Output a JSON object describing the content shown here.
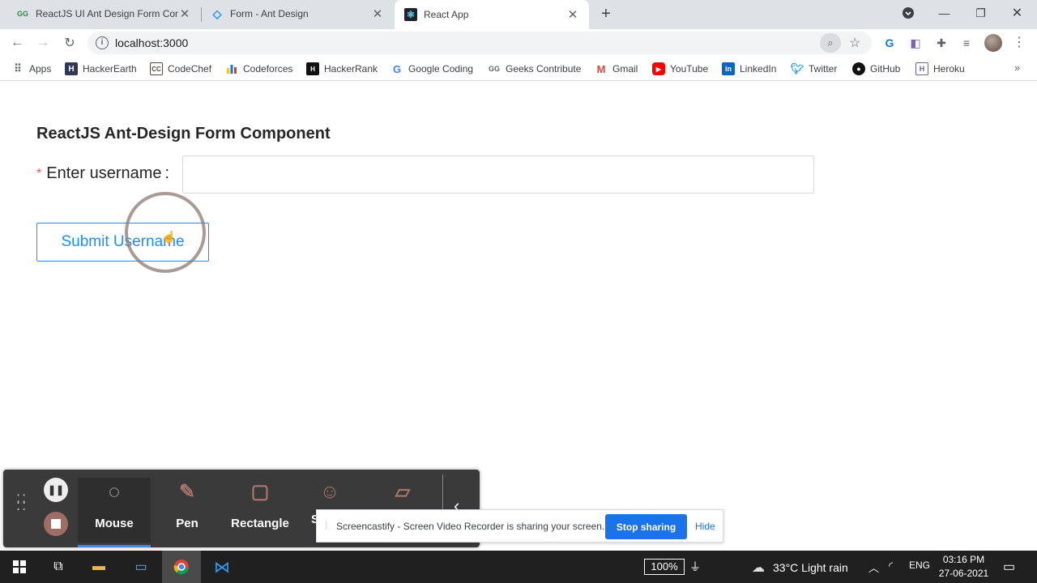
{
  "browser": {
    "tabs": [
      {
        "title": "ReactJS UI Ant Design Form Com",
        "favicon": "GG"
      },
      {
        "title": "Form - Ant Design",
        "favicon": "◇"
      },
      {
        "title": "React App",
        "favicon": "⚛"
      }
    ],
    "url": "localhost:3000",
    "bookmarks": [
      "Apps",
      "HackerEarth",
      "CodeChef",
      "Codeforces",
      "HackerRank",
      "Google Coding",
      "Geeks Contribute",
      "Gmail",
      "YouTube",
      "LinkedIn",
      "Twitter",
      "GitHub",
      "Heroku"
    ]
  },
  "page": {
    "title": "ReactJS Ant-Design Form Component",
    "field_required_mark": "*",
    "field_label": "Enter username",
    "field_colon": ":",
    "username_value": "",
    "submit_label": "Submit Username"
  },
  "recorder": {
    "tools": [
      "Mouse",
      "Pen",
      "Rectangle",
      "S"
    ],
    "active_tool": "Mouse",
    "share_message": "Screencastify - Screen Video Recorder is sharing your screen.",
    "stop_label": "Stop sharing",
    "hide_label": "Hide"
  },
  "taskbar": {
    "battery": "100%",
    "weather": "33°C  Light rain",
    "language": "ENG",
    "time": "03:16 PM",
    "date": "27-06-2021"
  },
  "colors": {
    "primary": "#1890ff",
    "required": "#ff4d4f",
    "share_button": "#1a73e8"
  }
}
